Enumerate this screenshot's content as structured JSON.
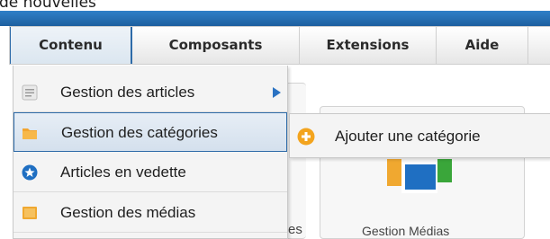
{
  "page": {
    "partial_heading": "de nouvelles"
  },
  "menubar": {
    "items": [
      {
        "label": "Contenu",
        "active": true
      },
      {
        "label": "Composants"
      },
      {
        "label": "Extensions"
      },
      {
        "label": "Aide"
      }
    ]
  },
  "background": {
    "partial_text": "es",
    "media_panel_label": "Gestion Médias"
  },
  "dropdown": {
    "items": [
      {
        "label": "Gestion des articles",
        "icon": "article-icon",
        "has_submenu": true
      },
      {
        "label": "Gestion des catégories",
        "icon": "folder-icon",
        "selected": true
      },
      {
        "label": "Articles en vedette",
        "icon": "star-icon"
      },
      {
        "label": "Gestion des médias",
        "icon": "media-icon"
      }
    ]
  },
  "submenu": {
    "items": [
      {
        "label": "Ajouter une catégorie",
        "icon": "add-icon"
      }
    ]
  },
  "colors": {
    "header_bar": "#1e5f9f",
    "active_border": "#2e6ba8",
    "folder": "#f2a531",
    "star_badge": "#1f6fc2",
    "add_badge": "#f3a41e"
  }
}
